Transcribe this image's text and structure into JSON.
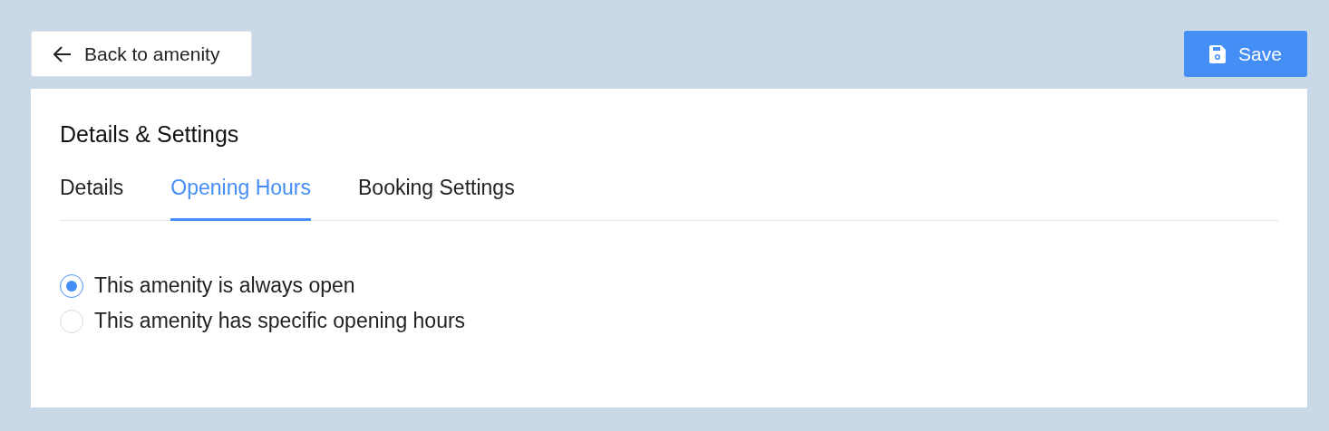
{
  "back_button": {
    "label": "Back to amenity"
  },
  "save_button": {
    "label": "Save"
  },
  "card": {
    "title": "Details & Settings",
    "tabs": [
      {
        "label": "Details",
        "selected": false
      },
      {
        "label": "Opening Hours",
        "selected": true
      },
      {
        "label": "Booking Settings",
        "selected": false
      }
    ],
    "options": [
      {
        "label": "This amenity is always open",
        "selected": true
      },
      {
        "label": "This amenity has specific opening hours",
        "selected": false
      }
    ]
  }
}
